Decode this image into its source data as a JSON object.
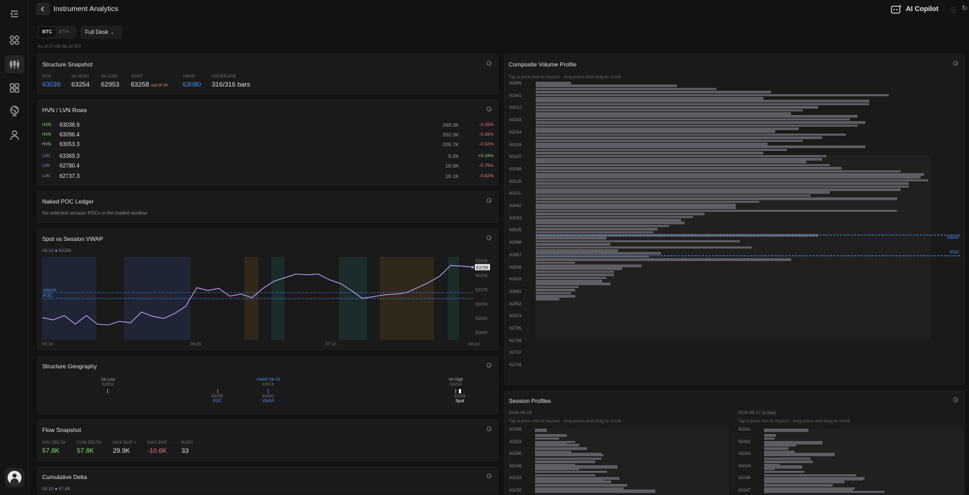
{
  "app": {
    "title": "Instrument Analytics",
    "copilot_label": "AI Copilot"
  },
  "sidebar": {
    "icons": [
      "collapse-menu-icon",
      "grid-icon",
      "candles-icon",
      "apps-icon",
      "globe-icon",
      "user-icon"
    ],
    "active": "candles-icon"
  },
  "controls": {
    "assets": [
      "BTC",
      "ETH"
    ],
    "selected_asset": "BTC",
    "desk": "Full Desk",
    "as_of": "As of 17-08 08:10 IST"
  },
  "structure_snapshot": {
    "title": "Structure Snapshot",
    "stats": [
      {
        "label": "POC",
        "value": "63039",
        "accent": "blue"
      },
      {
        "label": "VA HIGH",
        "value": "63254"
      },
      {
        "label": "VA LOW",
        "value": "62953"
      },
      {
        "label": "SPOT",
        "value": "63258",
        "tag": "out of VA"
      },
      {
        "label": "VWAP",
        "value": "63080",
        "accent": "blue"
      },
      {
        "label": "COVERAGE",
        "value": "316/316 bars"
      }
    ]
  },
  "hvn_lvn": {
    "title": "HVN / LVN Rows",
    "rows": [
      {
        "type": "HVN",
        "price": "63038.9",
        "volume": "269.3K",
        "change": "-0.35%"
      },
      {
        "type": "HVN",
        "price": "63096.4",
        "volume": "252.0K",
        "change": "-0.26%"
      },
      {
        "type": "HVN",
        "price": "63053.3",
        "volume": "209.7K",
        "change": "-0.32%"
      },
      {
        "type": "LVN",
        "price": "63369.3",
        "volume": "9.2K",
        "change": "+0.18%"
      },
      {
        "type": "LVN",
        "price": "62780.4",
        "volume": "18.8K",
        "change": "-0.75%"
      },
      {
        "type": "LVN",
        "price": "62737.3",
        "volume": "19.1K",
        "change": "-0.82%"
      }
    ]
  },
  "naked_poc": {
    "title": "Naked POC Ledger",
    "message": "No untested session POCs in the loaded window"
  },
  "spot_vwap": {
    "title": "Spot vs Session VWAP",
    "time": "08:10",
    "spot": "63258",
    "vwap_label": "VWAP",
    "poc_label": "POC"
  },
  "structure_geo": {
    "title": "Structure Geography",
    "markers": [
      {
        "top": "VA Low",
        "sub": "62953",
        "pct": 0.09,
        "pos": "top"
      },
      {
        "top": "VWAP 08-16",
        "sub": "63078",
        "pct": 0.5,
        "pos": "top",
        "blue": true
      },
      {
        "top": "VA High",
        "sub": "63254",
        "pct": 0.98,
        "pos": "top"
      },
      {
        "top": "63039",
        "sub": "POC",
        "pct": 0.37,
        "pos": "bottom"
      },
      {
        "top": "63080",
        "sub": "VWAP",
        "pct": 0.5,
        "pos": "bottom"
      },
      {
        "top": "63258",
        "sub": "Spot",
        "pct": 0.99,
        "pos": "bottom",
        "white": true
      }
    ]
  },
  "flow_snapshot": {
    "title": "Flow Snapshot",
    "stats": [
      {
        "label": "DAY DELTA",
        "value": "57.8K",
        "accent": "green"
      },
      {
        "label": "CUM DELTA",
        "value": "57.8K",
        "accent": "green"
      },
      {
        "label": "MAX BAR +",
        "value": "29.9K"
      },
      {
        "label": "MAX BAR -",
        "value": "-10.6K",
        "accent": "red"
      },
      {
        "label": "BARS",
        "value": "33"
      }
    ]
  },
  "cum_delta": {
    "title": "Cumulative Delta",
    "time": "08:10",
    "value": "57.8K"
  },
  "composite_profile": {
    "title": "Composite Volume Profile",
    "hint": "Tap a price row to inspect · long-press and drag to scrub",
    "vwap_label": "VWAP",
    "poc_label": "POC"
  },
  "session_profiles": {
    "title": "Session Profiles",
    "sessions": [
      {
        "date": "2026-08-16",
        "hint": "Tap a price row to inspect · long-press and drag to scrub",
        "prices": [
          "63366",
          "63323",
          "63280",
          "63236",
          "63193",
          "63150"
        ],
        "volumes": [
          0.06,
          0.16,
          0.33,
          0.41,
          0.34,
          0.6
        ]
      },
      {
        "date": "2026-08-17 (today)",
        "hint": "Tap a price row to inspect · long-press and drag to scrub",
        "prices": [
          "63341",
          "63302",
          "63263",
          "63224",
          "63186",
          "63147"
        ],
        "volumes": [
          0.22,
          0.29,
          0.35,
          0.19,
          0.49,
          0.44
        ]
      }
    ]
  },
  "chart_data": [
    {
      "type": "line",
      "title": "Spot vs Session VWAP",
      "x_ticks": [
        "05:30",
        "06:25",
        "07:15",
        "08:10"
      ],
      "y_ticks": [
        "63300",
        "63200",
        "63100",
        "63000",
        "62900",
        "62800"
      ],
      "ylim": [
        62750,
        63330
      ],
      "series": [
        {
          "values": [
            62905,
            62890,
            62920,
            62860,
            62920,
            62860,
            62855,
            62880,
            62870,
            62945,
            62915,
            62900,
            62935,
            62985,
            63115,
            63095,
            63110,
            63055,
            63070,
            63045,
            63110,
            63160,
            63185,
            63210,
            63205,
            63210,
            63170,
            63145,
            63095,
            63040,
            63052,
            63065,
            63070,
            63080,
            63115,
            63150,
            63195,
            63270,
            63265,
            63258
          ]
        }
      ],
      "vwap": 63080,
      "poc": 63039,
      "last": "63258"
    },
    {
      "type": "bar",
      "title": "Composite Volume Profile",
      "orientation": "horizontal",
      "categories": [
        "63369",
        "63341",
        "63312",
        "63283",
        "63254",
        "63226",
        "63197",
        "63168",
        "63139",
        "63111",
        "63082",
        "63053",
        "63025",
        "62996",
        "62967",
        "62938",
        "62910",
        "62881",
        "62852",
        "62823",
        "62795",
        "62766",
        "62737",
        "62709"
      ],
      "values": [
        9,
        36,
        46,
        60,
        90,
        58,
        85,
        85,
        72,
        68,
        65,
        82,
        80,
        84,
        82,
        67,
        61,
        79,
        73,
        68,
        59,
        84,
        64,
        58,
        74,
        73,
        69,
        75,
        78,
        93,
        99,
        98,
        100,
        95,
        95,
        93,
        75,
        70,
        92,
        57,
        51,
        51,
        92,
        43,
        40,
        37,
        38,
        34,
        31,
        30,
        72,
        18,
        52,
        19,
        55,
        21,
        32,
        29,
        65,
        10,
        27,
        22,
        20,
        20,
        18,
        17,
        19,
        11,
        10,
        9,
        10,
        6
      ],
      "vwap": 63082,
      "poc": 63039
    }
  ]
}
